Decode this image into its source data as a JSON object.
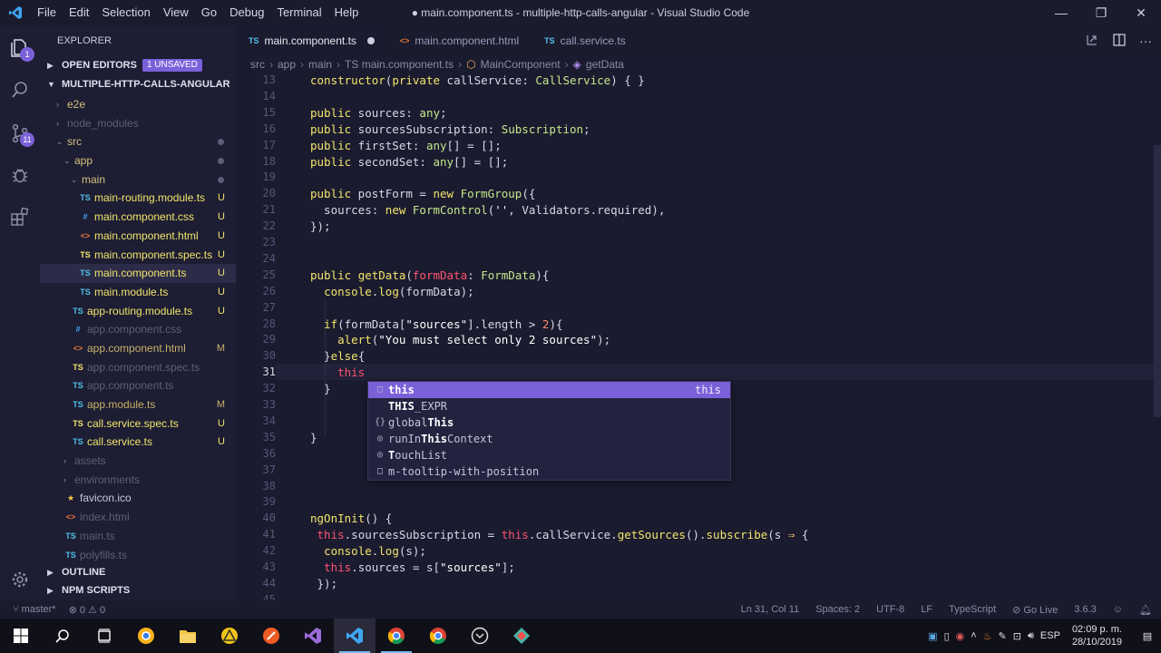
{
  "titlebar": {
    "menu": [
      "File",
      "Edit",
      "Selection",
      "View",
      "Go",
      "Debug",
      "Terminal",
      "Help"
    ],
    "title": "● main.component.ts - multiple-http-calls-angular - Visual Studio Code"
  },
  "activity": {
    "scm_badge": "11"
  },
  "explorer": {
    "header": "EXPLORER",
    "open_editors": "OPEN EDITORS",
    "unsaved_badge": "1 UNSAVED",
    "project": "MULTIPLE-HTTP-CALLS-ANGULAR",
    "outline": "OUTLINE",
    "npm_scripts": "NPM SCRIPTS",
    "tree": [
      {
        "label": "e2e",
        "indent": 1,
        "kind": "folder",
        "status": "",
        "dim": false
      },
      {
        "label": "node_modules",
        "indent": 1,
        "kind": "folder",
        "status": "",
        "dim": true
      },
      {
        "label": "src",
        "indent": 1,
        "kind": "folder-open",
        "status": "dot",
        "dim": false
      },
      {
        "label": "app",
        "indent": 2,
        "kind": "folder-open",
        "status": "dot",
        "dim": false
      },
      {
        "label": "main",
        "indent": 3,
        "kind": "folder-open",
        "status": "dot",
        "dim": false
      },
      {
        "label": "main-routing.module.ts",
        "indent": 4,
        "kind": "ts",
        "status": "U",
        "dim": false
      },
      {
        "label": "main.component.css",
        "indent": 4,
        "kind": "css",
        "status": "U",
        "dim": false
      },
      {
        "label": "main.component.html",
        "indent": 4,
        "kind": "html",
        "status": "U",
        "dim": false
      },
      {
        "label": "main.component.spec.ts",
        "indent": 4,
        "kind": "ts-spec",
        "status": "U",
        "dim": false
      },
      {
        "label": "main.component.ts",
        "indent": 4,
        "kind": "ts",
        "status": "U",
        "dim": false,
        "selected": true
      },
      {
        "label": "main.module.ts",
        "indent": 4,
        "kind": "ts",
        "status": "U",
        "dim": false
      },
      {
        "label": "app-routing.module.ts",
        "indent": 3,
        "kind": "ts",
        "status": "U",
        "dim": false
      },
      {
        "label": "app.component.css",
        "indent": 3,
        "kind": "css",
        "status": "",
        "dim": true
      },
      {
        "label": "app.component.html",
        "indent": 3,
        "kind": "html",
        "status": "M",
        "dim": false
      },
      {
        "label": "app.component.spec.ts",
        "indent": 3,
        "kind": "ts-spec",
        "status": "",
        "dim": true
      },
      {
        "label": "app.component.ts",
        "indent": 3,
        "kind": "ts",
        "status": "",
        "dim": true
      },
      {
        "label": "app.module.ts",
        "indent": 3,
        "kind": "ts",
        "status": "M",
        "dim": false
      },
      {
        "label": "call.service.spec.ts",
        "indent": 3,
        "kind": "ts-spec",
        "status": "U",
        "dim": false
      },
      {
        "label": "call.service.ts",
        "indent": 3,
        "kind": "ts",
        "status": "U",
        "dim": false
      },
      {
        "label": "assets",
        "indent": 2,
        "kind": "folder",
        "status": "",
        "dim": true
      },
      {
        "label": "environments",
        "indent": 2,
        "kind": "folder",
        "status": "",
        "dim": true
      },
      {
        "label": "favicon.ico",
        "indent": 2,
        "kind": "star",
        "status": "",
        "dim": false
      },
      {
        "label": "index.html",
        "indent": 2,
        "kind": "html",
        "status": "",
        "dim": true
      },
      {
        "label": "main.ts",
        "indent": 2,
        "kind": "ts",
        "status": "",
        "dim": true
      },
      {
        "label": "polyfills.ts",
        "indent": 2,
        "kind": "ts",
        "status": "",
        "dim": true
      }
    ]
  },
  "tabs": [
    {
      "label": "main.component.ts",
      "icon": "TS",
      "active": true,
      "dirty": true
    },
    {
      "label": "main.component.html",
      "icon": "<>",
      "active": false,
      "dirty": false
    },
    {
      "label": "call.service.ts",
      "icon": "TS",
      "active": false,
      "dirty": false
    }
  ],
  "breadcrumb": [
    "src",
    "app",
    "main",
    "TS main.component.ts",
    "MainComponent",
    "getData"
  ],
  "editor": {
    "line_numbers": [
      "13",
      "14",
      "15",
      "16",
      "17",
      "18",
      "19",
      "20",
      "21",
      "22",
      "23",
      "24",
      "25",
      "26",
      "27",
      "28",
      "29",
      "30",
      "31",
      "32",
      "33",
      "34",
      "35",
      "36",
      "37",
      "38",
      "39",
      "40",
      "41",
      "42",
      "43",
      "44",
      "45"
    ],
    "current_line": "31"
  },
  "suggestions": [
    {
      "icon": "□",
      "bold": "this",
      "rest": "",
      "pre": "",
      "hint": "this",
      "selected": true
    },
    {
      "icon": "",
      "bold": "THIS",
      "rest": "_EXPR",
      "pre": "",
      "hint": "",
      "selected": false
    },
    {
      "icon": "{}",
      "bold": "This",
      "rest": "",
      "pre": "global",
      "hint": "",
      "selected": false
    },
    {
      "icon": "◎",
      "bold": "This",
      "rest": "Context",
      "pre": "runIn",
      "hint": "",
      "selected": false
    },
    {
      "icon": "◎",
      "bold": "T",
      "rest": "ouchList",
      "pre": "",
      "hint": "",
      "selected": false
    },
    {
      "icon": "□",
      "bold": "",
      "rest": "m-tooltip-with-position",
      "pre": "",
      "hint": "",
      "selected": false
    }
  ],
  "statusbar": {
    "branch": "master*",
    "problems": "⊗ 0 ⚠ 0",
    "position": "Ln 31, Col 11",
    "spaces": "Spaces: 2",
    "encoding": "UTF-8",
    "eol": "LF",
    "language": "TypeScript",
    "golive": "Go Live",
    "version": "3.6.3"
  },
  "taskbar": {
    "language": "ESP",
    "time": "02:09 p. m.",
    "date": "28/10/2019"
  }
}
